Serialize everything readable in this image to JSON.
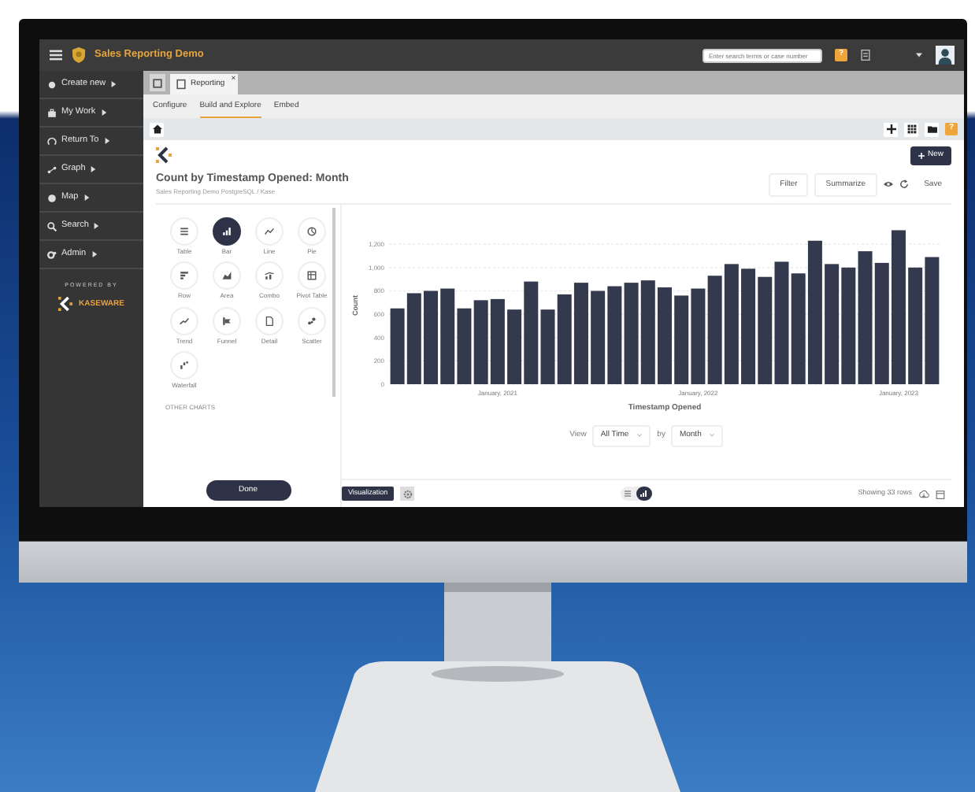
{
  "topbar": {
    "title": "Sales Reporting Demo",
    "search": {
      "placeholder": "Enter search terms or case number"
    },
    "help": "?"
  },
  "sidebar": {
    "items": [
      {
        "label": "Create new"
      },
      {
        "label": "My Work"
      },
      {
        "label": "Return To"
      },
      {
        "label": "Graph"
      },
      {
        "label": "Map"
      },
      {
        "label": "Search"
      },
      {
        "label": "Admin"
      }
    ],
    "powered_by": "POWERED BY",
    "brand": "KASEWARE"
  },
  "tabs": [
    {
      "label": "Reporting",
      "close": "×",
      "selected": true
    }
  ],
  "subtabs": [
    {
      "label": "Configure",
      "selected": false
    },
    {
      "label": "Build and Explore",
      "selected": true
    },
    {
      "label": "Embed",
      "selected": false
    }
  ],
  "toolbar": {
    "help": "?"
  },
  "question": {
    "new_button": "New",
    "title": "Count by Timestamp Opened: Month",
    "breadcrumb": "Sales Reporting Demo PostgreSQL / Kase",
    "filter_button": "Filter",
    "summarize_button": "Summarize",
    "save_button": "Save"
  },
  "chart_types": [
    {
      "label": "Table",
      "selected": false
    },
    {
      "label": "Bar",
      "selected": true
    },
    {
      "label": "Line",
      "selected": false
    },
    {
      "label": "Pie",
      "selected": false
    },
    {
      "label": "Row",
      "selected": false
    },
    {
      "label": "Area",
      "selected": false
    },
    {
      "label": "Combo",
      "selected": false
    },
    {
      "label": "Pivot Table",
      "selected": false
    },
    {
      "label": "Trend",
      "selected": false
    },
    {
      "label": "Funnel",
      "selected": false
    },
    {
      "label": "Detail",
      "selected": false
    },
    {
      "label": "Scatter",
      "selected": false
    },
    {
      "label": "Waterfall",
      "selected": false
    }
  ],
  "other_charts": "OTHER CHARTS",
  "done_button": "Done",
  "chart_data": {
    "type": "bar",
    "xlabel": "Timestamp Opened",
    "ylabel": "Count",
    "categories": [
      null,
      null,
      null,
      null,
      null,
      null,
      "January, 2021",
      null,
      null,
      null,
      null,
      null,
      null,
      null,
      null,
      null,
      null,
      null,
      "January, 2022",
      null,
      null,
      null,
      null,
      null,
      null,
      null,
      null,
      null,
      null,
      null,
      "January, 2023",
      null,
      null
    ],
    "series": [
      {
        "color": "#343a4e",
        "values": [
          650,
          780,
          800,
          820,
          650,
          720,
          730,
          640,
          880,
          640,
          770,
          870,
          800,
          840,
          870,
          890,
          830,
          760,
          820,
          930,
          1030,
          990,
          920,
          1050,
          950,
          1230,
          1030,
          1000,
          1140,
          1040,
          1320,
          1000,
          1090
        ]
      }
    ],
    "grid": true,
    "ylim": [
      0,
      1350
    ],
    "yticks": [
      0,
      200,
      400,
      600,
      800,
      {
        "value": 1000,
        "label": "1,000"
      },
      {
        "value": 1200,
        "label": "1,200"
      }
    ]
  },
  "view": {
    "label": "View",
    "range": "All Time",
    "by": "by",
    "unit": "Month"
  },
  "footer": {
    "visualization_button": "Visualization",
    "display": [
      {
        "selected": false
      },
      {
        "selected": true
      }
    ],
    "row_count": "Showing 33 rows"
  }
}
